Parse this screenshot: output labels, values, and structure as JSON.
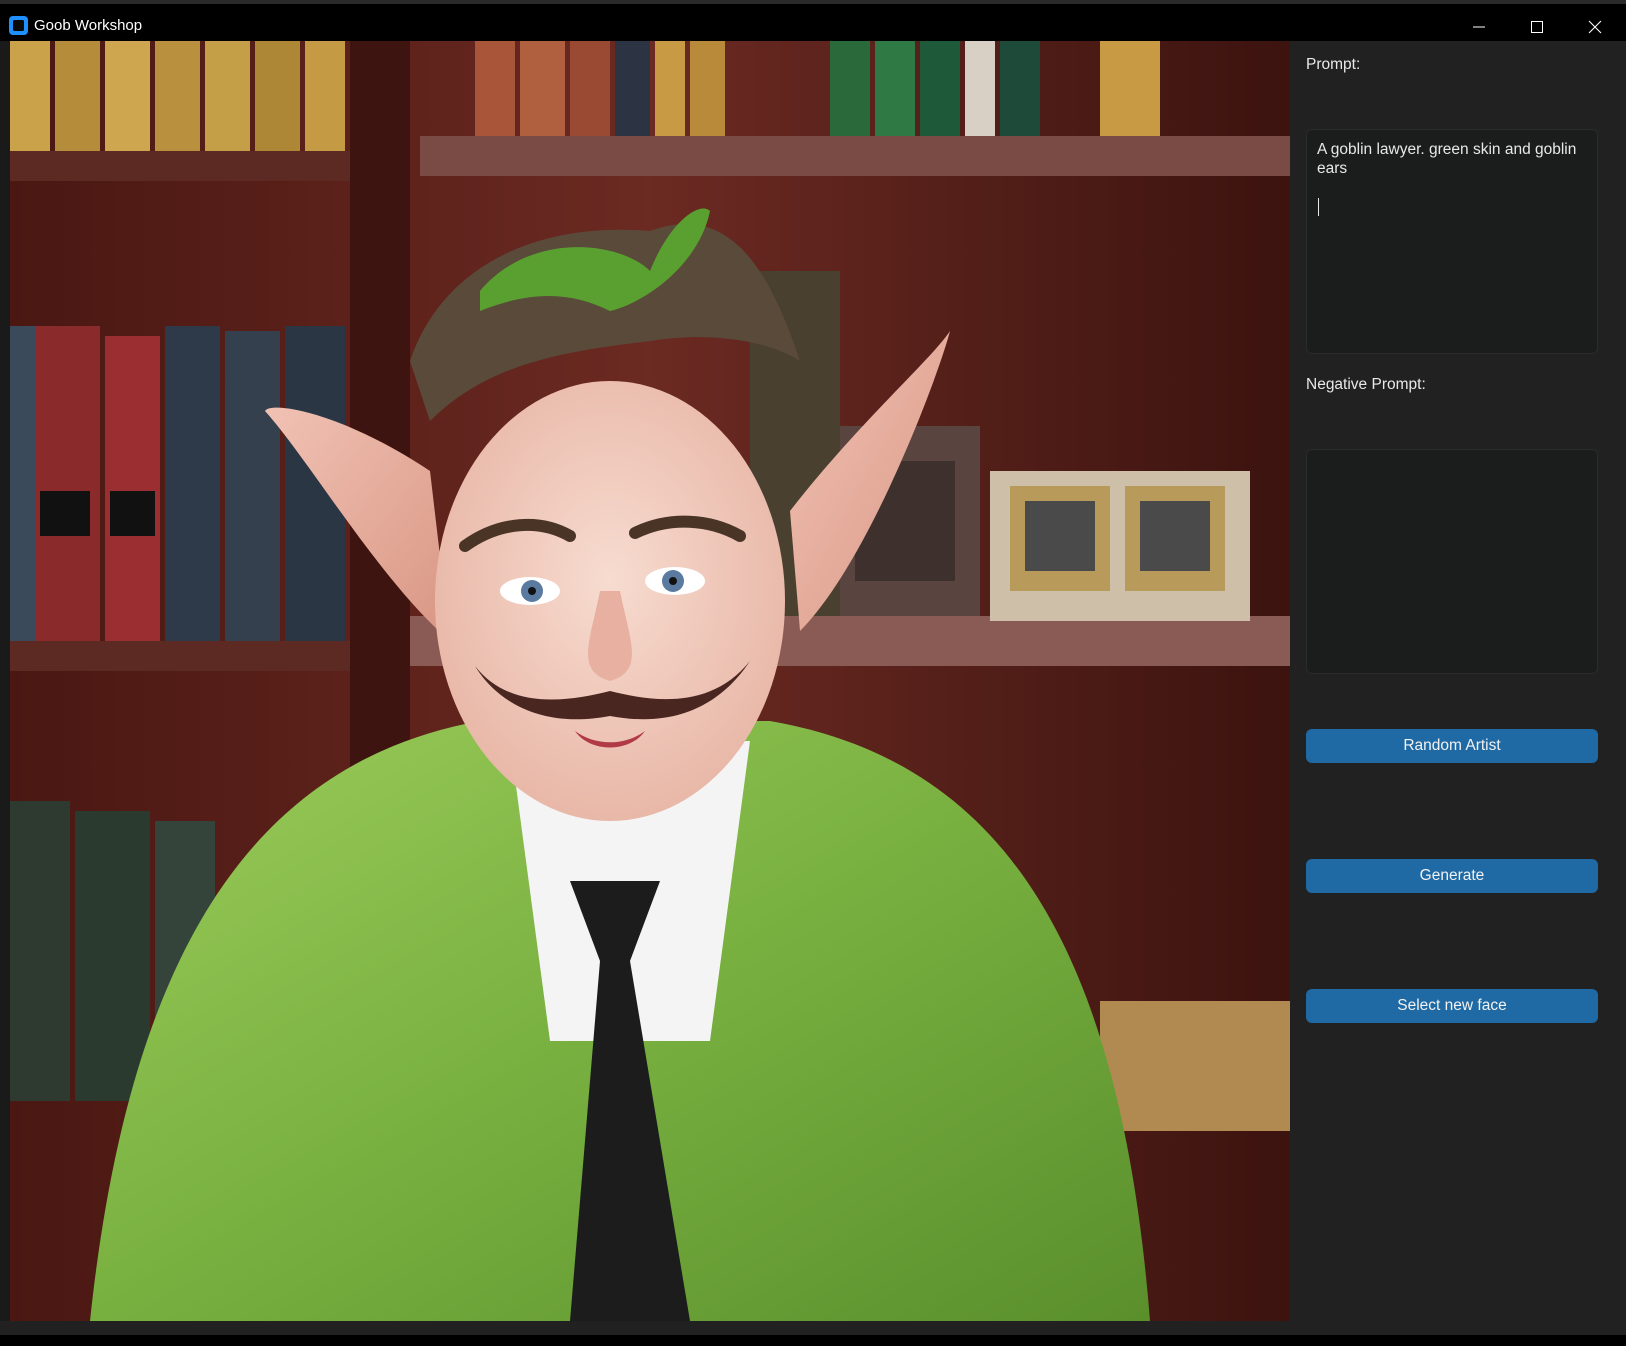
{
  "window": {
    "title": "Goob Workshop",
    "icon": "app-window-icon",
    "controls": [
      "minimize-icon",
      "maximize-icon",
      "close-icon"
    ]
  },
  "image": {
    "alt_icon": "generated-image"
  },
  "sidebar": {
    "prompt_label": "Prompt:",
    "prompt_value": "A goblin lawyer. green skin and goblin ears",
    "negative_label": "Negative Prompt:",
    "negative_value": "",
    "buttons": {
      "random_artist": "Random Artist",
      "generate": "Generate",
      "select_face": "Select new face"
    }
  },
  "colors": {
    "accent": "#1f6aa5",
    "panel": "#212121",
    "textbox": "#1b1c1c",
    "titlebar": "#000000"
  }
}
